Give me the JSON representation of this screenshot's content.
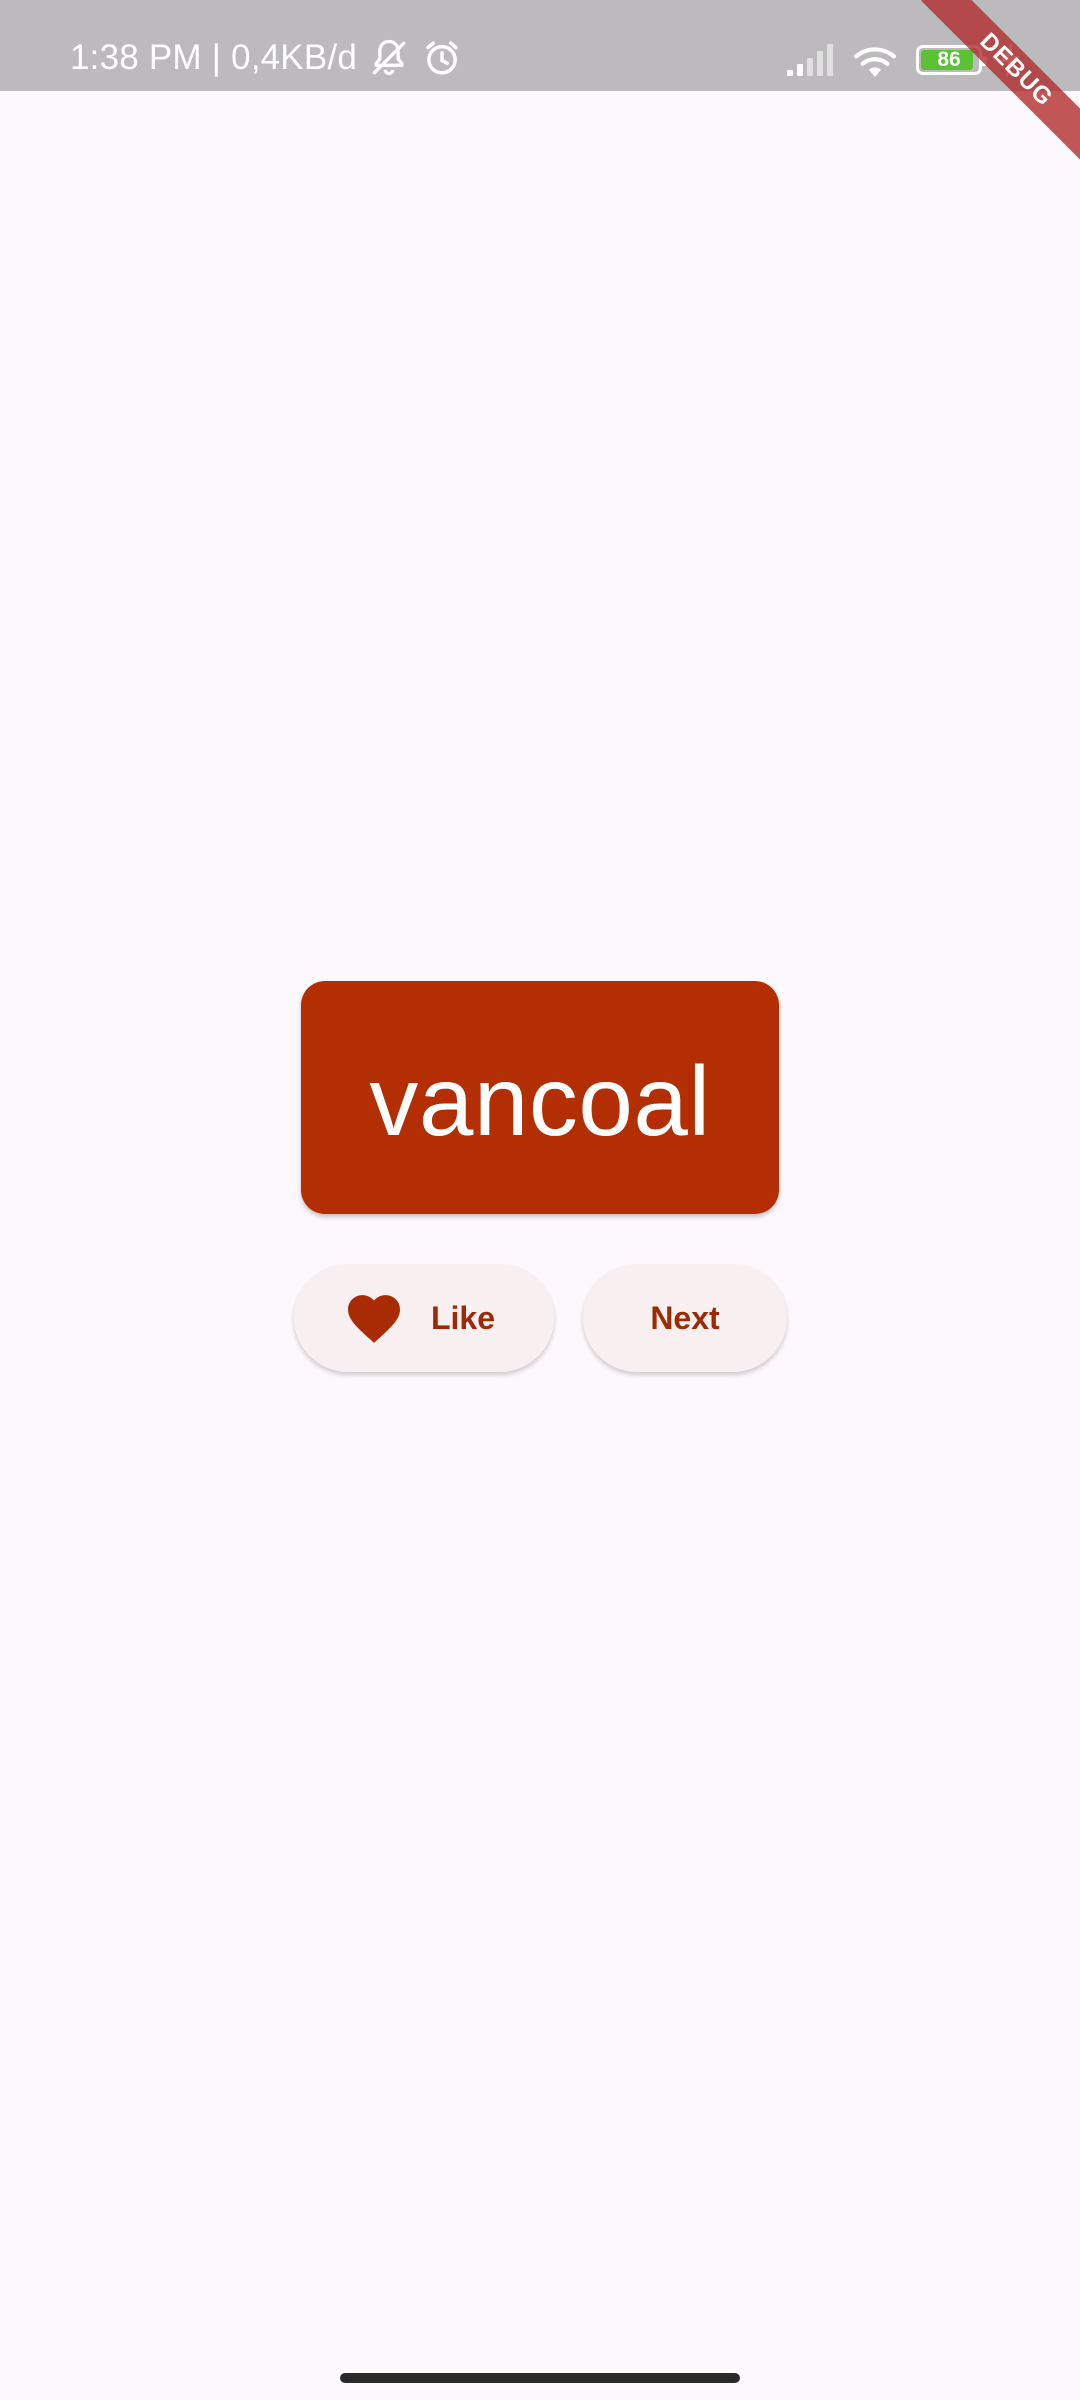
{
  "status_bar": {
    "time": "1:38 PM",
    "separator": "|",
    "network_speed": "0,4KB/d",
    "battery_level": "86",
    "icons": [
      "muted-bell-icon",
      "alarm-icon",
      "signal-icon",
      "wifi-icon",
      "battery-icon",
      "charging-icon"
    ],
    "colors": {
      "background": "#bcbabd",
      "battery_fill": "#5bc236"
    }
  },
  "debug_banner": {
    "label": "DEBUG"
  },
  "word_card": {
    "word": "vancoal",
    "color": "#b32f03"
  },
  "actions": {
    "like": {
      "label": "Like",
      "icon": "heart-icon"
    },
    "next": {
      "label": "Next"
    }
  },
  "theme": {
    "background": "#fdf8fc",
    "button_background": "#f8eff0",
    "accent": "#9c2a06"
  }
}
